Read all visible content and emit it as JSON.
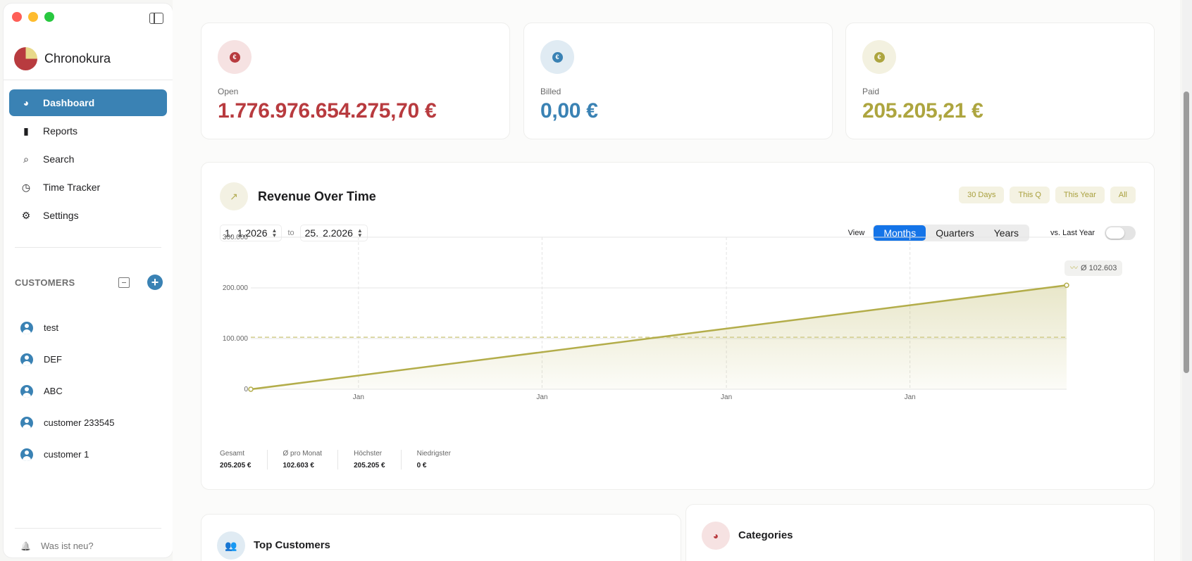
{
  "app": {
    "name": "Chronokura"
  },
  "nav": [
    {
      "label": "Dashboard",
      "icon": "pie-chart-icon",
      "glyph": "◕",
      "active": true
    },
    {
      "label": "Reports",
      "icon": "bar-chart-icon",
      "glyph": "▮",
      "active": false
    },
    {
      "label": "Search",
      "icon": "search-icon",
      "glyph": "⌕",
      "active": false
    },
    {
      "label": "Time Tracker",
      "icon": "timer-icon",
      "glyph": "◷",
      "active": false
    },
    {
      "label": "Settings",
      "icon": "gear-icon",
      "glyph": "⚙",
      "active": false
    }
  ],
  "customers": {
    "title": "CUSTOMERS",
    "add_label": "+",
    "items": [
      "test",
      "DEF",
      "ABC",
      "customer 233545",
      "customer 1"
    ]
  },
  "footer": {
    "whats_new": "Was ist neu?",
    "bell_glyph": "🔔"
  },
  "kpis": [
    {
      "label": "Open",
      "value": "1.776.976.654.275,70 €",
      "color": "#b83b3f",
      "icon_bg": "#f6e2e2",
      "icon_symbol": "€"
    },
    {
      "label": "Billed",
      "value": "0,00 €",
      "color": "#3a82b4",
      "icon_bg": "#e0ebf3",
      "icon_symbol": "€"
    },
    {
      "label": "Paid",
      "value": "205.205,21 €",
      "color": "#ada53f",
      "icon_bg": "#f3f1e0",
      "icon_symbol": "€"
    }
  ],
  "revenue": {
    "title": "Revenue Over Time",
    "icon_glyph": "↗",
    "ranges": [
      "30 Days",
      "This Q",
      "This Year",
      "All"
    ],
    "date_from": {
      "day": "1.",
      "month_year": "1.2026"
    },
    "to_label": "to",
    "date_to": {
      "day": "25.",
      "month_year": "2.2026"
    },
    "view_label": "View",
    "views": [
      {
        "label": "Months",
        "active": true
      },
      {
        "label": "Quarters",
        "active": false
      },
      {
        "label": "Years",
        "active": false
      }
    ],
    "compare_label": "vs. Last Year",
    "avg_badge": "Ø 102.603",
    "avg_wave": "〰",
    "stats": [
      {
        "label": "Gesamt",
        "value": "205.205 €"
      },
      {
        "label": "Ø pro Monat",
        "value": "102.603 €"
      },
      {
        "label": "Höchster",
        "value": "205.205 €"
      },
      {
        "label": "Niedrigster",
        "value": "0 €"
      }
    ]
  },
  "chart_data": {
    "type": "area",
    "y_ticks": [
      "300.000",
      "200.000",
      "100.000",
      "0"
    ],
    "ylim": [
      0,
      300000
    ],
    "x_ticks": [
      "Jan",
      "Jan",
      "Jan",
      "Jan"
    ],
    "points": [
      {
        "x": 0,
        "y": 0
      },
      {
        "x": 1,
        "y": 205205
      }
    ],
    "average": 102603,
    "color": "#b3ad4a",
    "grid": true
  },
  "sections": {
    "top_customers": {
      "title": "Top Customers",
      "icon_glyph": "👥"
    },
    "categories": {
      "title": "Categories",
      "icon_glyph": "◕"
    }
  }
}
